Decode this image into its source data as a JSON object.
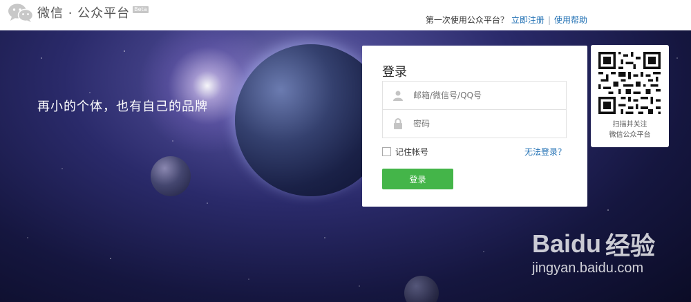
{
  "header": {
    "logo_text": "微信 · 公众平台",
    "beta": "Beta",
    "first_time": "第一次使用公众平台？",
    "register": "立即注册",
    "separator": "|",
    "help": "使用帮助"
  },
  "banner": {
    "slogan": "再小的个体，也有自己的品牌"
  },
  "login": {
    "title": "登录",
    "username_placeholder": "邮箱/微信号/QQ号",
    "password_placeholder": "密码",
    "remember": "记住帐号",
    "forgot": "无法登录？",
    "submit": "登录"
  },
  "qr": {
    "line1": "扫描并关注",
    "line2": "微信公众平台"
  },
  "watermark": {
    "brand_a": "Bai",
    "brand_b": "du",
    "brand_c": "经验",
    "url": "jingyan.baidu.com"
  },
  "colors": {
    "accent_green": "#44b549",
    "link_blue": "#1f6fb3"
  },
  "icons": [
    "wechat-logo-icon",
    "user-icon",
    "lock-icon",
    "qr-code-icon",
    "baidu-paw-icon"
  ]
}
